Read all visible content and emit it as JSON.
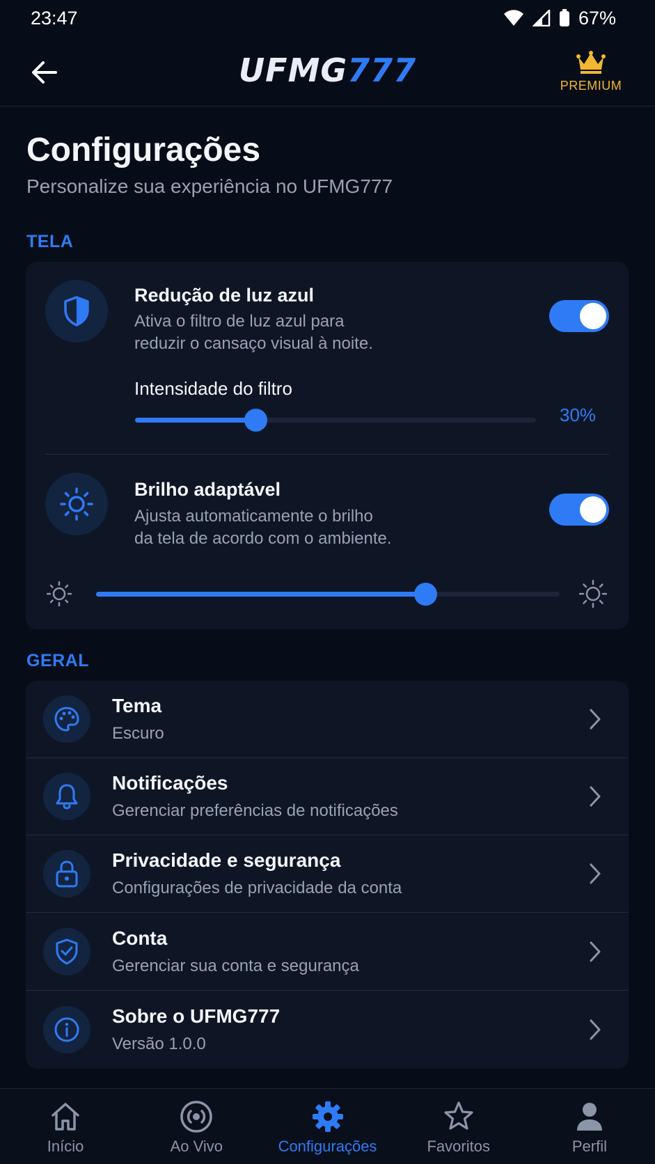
{
  "status_bar": {
    "time": "23:47",
    "battery": "67%"
  },
  "app_bar": {
    "logo_part1": "UFMG",
    "logo_part2": "777",
    "premium_label": "PREMIUM"
  },
  "page": {
    "title": "Configurações",
    "subtitle": "Personalize sua experiência no UFMG777"
  },
  "sections": {
    "screen": {
      "label": "TELA",
      "blue_light": {
        "title": "Redução de luz azul",
        "description_line1": "Ativa o filtro de luz azul para",
        "description_line2": "reduzir o cansaço visual à noite.",
        "enabled": true,
        "intensity_label": "Intensidade do filtro",
        "intensity_value": "30%",
        "intensity_fraction": 0.3
      },
      "adaptive_brightness": {
        "title": "Brilho adaptável",
        "description_line1": "Ajusta automaticamente o brilho",
        "description_line2": "da tela de acordo com o ambiente.",
        "enabled": true,
        "brightness_fraction": 0.71
      }
    },
    "general": {
      "label": "GERAL",
      "items": [
        {
          "title": "Tema",
          "subtitle": "Escuro",
          "icon": "palette-icon"
        },
        {
          "title": "Notificações",
          "subtitle": "Gerenciar preferências de notificações",
          "icon": "bell-icon"
        },
        {
          "title": "Privacidade e segurança",
          "subtitle": "Configurações de privacidade da conta",
          "icon": "lock-icon"
        },
        {
          "title": "Conta",
          "subtitle": "Gerenciar sua conta e segurança",
          "icon": "shield-check-icon"
        },
        {
          "title": "Sobre o UFMG777",
          "subtitle": "Versão 1.0.0",
          "icon": "info-icon"
        }
      ]
    }
  },
  "bottom_nav": [
    {
      "label": "Início",
      "icon": "home-icon",
      "active": false
    },
    {
      "label": "Ao Vivo",
      "icon": "live-icon",
      "active": false
    },
    {
      "label": "Configurações",
      "icon": "gear-icon",
      "active": true
    },
    {
      "label": "Favoritos",
      "icon": "star-icon",
      "active": false
    },
    {
      "label": "Perfil",
      "icon": "person-icon",
      "active": false
    }
  ],
  "colors": {
    "background": "#070d18",
    "card": "#0e1626",
    "accent": "#2f7bf5",
    "premium": "#f2b632"
  }
}
